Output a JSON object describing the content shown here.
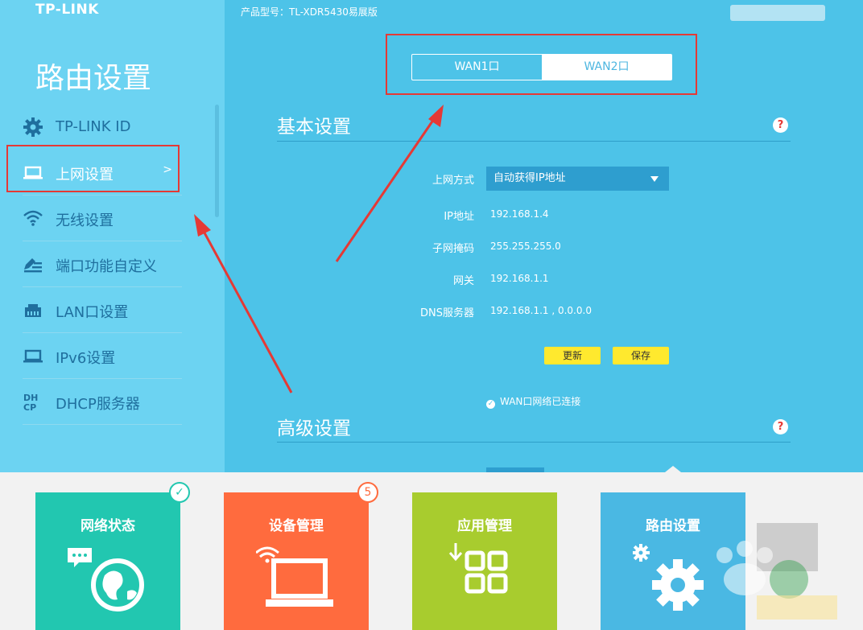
{
  "app": {
    "brand": "TP-LINK",
    "model": "产品型号：TL-XDR5430易展版"
  },
  "sidebar": {
    "title": "路由设置",
    "items": [
      {
        "label": "TP-LINK ID",
        "icon": "gear-icon"
      },
      {
        "label": "上网设置",
        "icon": "laptop-icon",
        "active": true,
        "arrow": ">"
      },
      {
        "label": "无线设置",
        "icon": "wifi-icon"
      },
      {
        "label": "端口功能自定义",
        "icon": "edit-list-icon"
      },
      {
        "label": "LAN口设置",
        "icon": "lan-icon"
      },
      {
        "label": "IPv6设置",
        "icon": "laptop-icon"
      },
      {
        "label": "DHCP服务器",
        "icon": "dhcp-icon"
      }
    ]
  },
  "wan_tabs": [
    {
      "label": "WAN1口",
      "active": false
    },
    {
      "label": "WAN2口",
      "active": true
    }
  ],
  "basic": {
    "title": "基本设置",
    "help": "?",
    "connection_label": "上网方式",
    "connection_value": "自动获得IP地址",
    "ip_label": "IP地址",
    "ip_value": "192.168.1.4",
    "mask_label": "子网掩码",
    "mask_value": "255.255.255.0",
    "gateway_label": "网关",
    "gateway_value": "192.168.1.1",
    "dns_label": "DNS服务器",
    "dns_value": "192.168.1.1 , 0.0.0.0",
    "refresh_button": "更新",
    "save_button": "保存",
    "status_text": "WAN口网络已连接"
  },
  "advanced": {
    "title": "高级设置",
    "help": "?"
  },
  "tiles": [
    {
      "label": "网络状态",
      "color": "#22c7b0",
      "icon": "globe-chat-icon",
      "badge": "✓"
    },
    {
      "label": "设备管理",
      "color": "#ff6b3e",
      "icon": "wifi-laptop-icon",
      "badge": "5"
    },
    {
      "label": "应用管理",
      "color": "#a8cc2e",
      "icon": "app-grid-icon"
    },
    {
      "label": "路由设置",
      "color": "#4ab8e3",
      "icon": "gears-icon",
      "active": true
    }
  ],
  "colors": {
    "sidebar": "#6cd3f2",
    "main": "#4dc3e8",
    "highlight": "#e53935",
    "button": "#ffe92e"
  }
}
